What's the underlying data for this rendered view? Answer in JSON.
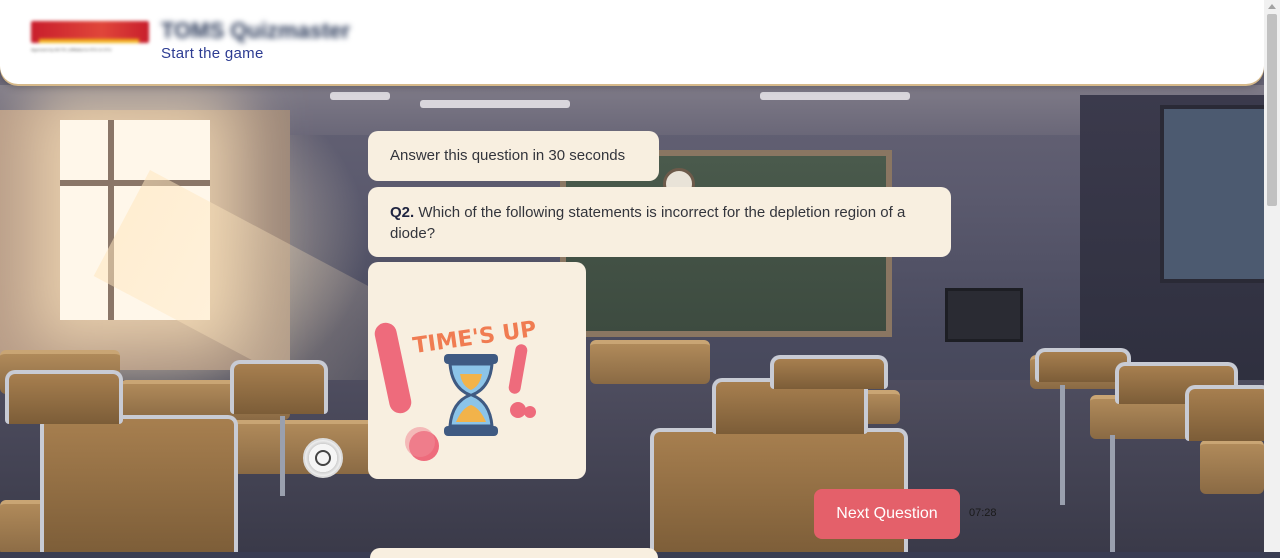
{
  "header": {
    "app_title": "TOMS Quizmaster",
    "subtitle_link": "Start the game",
    "logo_subtext": "Approved by AICTE | Affiliated to RTU & GTU"
  },
  "chat": {
    "timer_message": "Answer this question in 30 seconds",
    "question": {
      "number": "Q2.",
      "text": "Which of the following statements is incorrect for the depletion region of a diode?"
    },
    "image_text": "TIME'S UP"
  },
  "controls": {
    "next_button_label": "Next Question",
    "timestamp": "07:28"
  },
  "colors": {
    "accent_button": "#e4606a",
    "bubble_bg": "#f8efe0",
    "link": "#2d3c92",
    "timesup_text": "#f07c52",
    "timesup_pink": "#ee6b7c",
    "hourglass_blue": "#8cc4e8",
    "sand": "#f2b34a"
  },
  "icons": {
    "hourglass": "hourglass-icon",
    "exclamation": "exclamation-icon",
    "emblem": "emblem-icon"
  }
}
